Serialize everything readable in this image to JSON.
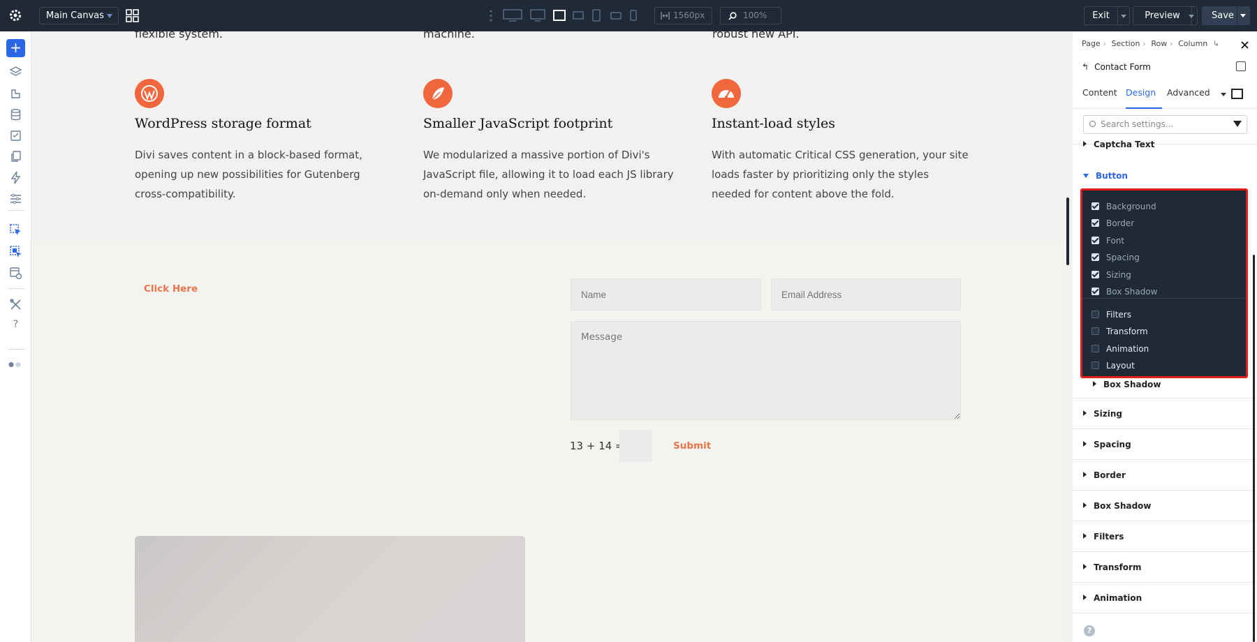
{
  "topbar": {
    "canvas_label": "Main Canvas",
    "width_value": "1560px",
    "zoom_value": "100%",
    "exit_label": "Exit",
    "preview_label": "Preview",
    "save_label": "Save"
  },
  "canvas": {
    "cut_texts": [
      "flexible system.",
      "machine.",
      "robust new API."
    ],
    "features": [
      {
        "title": "WordPress storage format",
        "body": "Divi saves content in a block-based format, opening up new possibilities for Gutenberg cross-compatibility.",
        "icon": "wordpress-icon"
      },
      {
        "title": "Smaller JavaScript footprint",
        "body": "We modularized a massive portion of Divi's JavaScript file, allowing it to load each JS library on-demand only when needed.",
        "icon": "feather-icon"
      },
      {
        "title": "Instant-load styles",
        "body": "With automatic Critical CSS generation, your site loads faster by prioritizing only the styles needed for content above the fold.",
        "icon": "speedometer-icon"
      }
    ],
    "click_here": "Click Here",
    "form": {
      "name_placeholder": "Name",
      "email_placeholder": "Email Address",
      "message_placeholder": "Message",
      "captcha_question": "13 + 14 =",
      "submit_label": "Submit"
    }
  },
  "panel": {
    "breadcrumbs": [
      "Page",
      "Section",
      "Row",
      "Column"
    ],
    "module_name": "Contact Form",
    "tabs": [
      "Content",
      "Design",
      "Advanced"
    ],
    "active_tab": "Design",
    "search_placeholder": "Search settings...",
    "groups_top": [
      "Captcha Text",
      "Button"
    ],
    "dropdown_checked": [
      "Background",
      "Border",
      "Font",
      "Spacing",
      "Sizing",
      "Box Shadow"
    ],
    "dropdown_unchecked": [
      "Filters",
      "Transform",
      "Animation",
      "Layout"
    ],
    "sub_group": "Box Shadow",
    "groups_bottom": [
      "Sizing",
      "Spacing",
      "Border",
      "Box Shadow",
      "Filters",
      "Transform",
      "Animation"
    ]
  },
  "colors": {
    "accent": "#2c67e6",
    "orange": "#f0673d",
    "highlight": "#e11d1d",
    "topbar": "#1f2a36"
  }
}
